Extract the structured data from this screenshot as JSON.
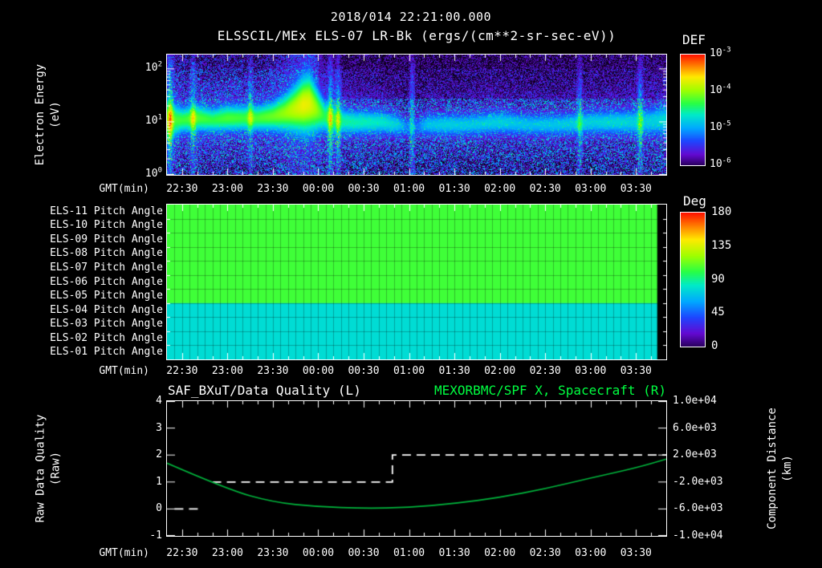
{
  "title": "2018/014 22:21:00.000",
  "subtitle_left": "ELSSCIL/MEx ELS-07 LR-Bk",
  "subtitle_right": "(ergs/(cm**2-sr-sec-eV))",
  "gmt_label": "GMT(min)",
  "time_ticks": [
    "22:30",
    "23:00",
    "23:30",
    "00:00",
    "00:30",
    "01:00",
    "01:30",
    "02:00",
    "02:30",
    "03:00",
    "03:30"
  ],
  "colors": {
    "background": "#000000",
    "text": "#ffffff",
    "accent_green": "#00ff41",
    "curve_green": "#00b43c"
  },
  "spectrogram": {
    "ylabel_line1": "Electron Energy",
    "ylabel_line2": "(eV)",
    "y_ticks": [
      {
        "base": "10",
        "exp": "2"
      },
      {
        "base": "10",
        "exp": "1"
      },
      {
        "base": "10",
        "exp": "0"
      }
    ],
    "colorbar": {
      "title": "DEF",
      "ticks": [
        {
          "base": "10",
          "exp": "-3"
        },
        {
          "base": "10",
          "exp": "-4"
        },
        {
          "base": "10",
          "exp": "-5"
        },
        {
          "base": "10",
          "exp": "-6"
        }
      ]
    }
  },
  "pitch_panel": {
    "rows": [
      "ELS-11 Pitch Angle",
      "ELS-10 Pitch Angle",
      "ELS-09 Pitch Angle",
      "ELS-08 Pitch Angle",
      "ELS-07 Pitch Angle",
      "ELS-06 Pitch Angle",
      "ELS-05 Pitch Angle",
      "ELS-04 Pitch Angle",
      "ELS-03 Pitch Angle",
      "ELS-02 Pitch Angle",
      "ELS-01 Pitch Angle"
    ],
    "colorbar": {
      "title": "Deg",
      "ticks": [
        "180",
        "135",
        "90",
        "45",
        "0"
      ]
    }
  },
  "line_chart": {
    "title_left": "SAF_BXuT/Data Quality (L)",
    "title_right": "MEXORBMC/SPF X, Spacecraft (R)",
    "left_axis": {
      "label_line1": "Raw Data Quality",
      "label_line2": "(Raw)",
      "ticks": [
        "4",
        "3",
        "2",
        "1",
        "0",
        "-1"
      ]
    },
    "right_axis": {
      "label_line1": "Component Distance",
      "label_line2": "(km)",
      "ticks": [
        "1.0e+04",
        "6.0e+03",
        "2.0e+03",
        "-2.0e+03",
        "-6.0e+03",
        "-1.0e+04"
      ]
    }
  },
  "chart_data": [
    {
      "type": "heatmap",
      "title": "ELSSCIL/MEx ELS-07 LR-Bk",
      "units": "ergs/(cm**2-sr-sec-eV)",
      "xlabel": "GMT(min)",
      "x_start": "22:20",
      "x_end": "03:50",
      "x_span_minutes": 330,
      "x_ticks": [
        "22:30",
        "23:00",
        "23:30",
        "00:00",
        "00:30",
        "01:00",
        "01:30",
        "02:00",
        "02:30",
        "03:00",
        "03:30"
      ],
      "ylabel": "Electron Energy (eV)",
      "y_scale": "log",
      "y_ticks_eV": [
        1,
        10,
        100
      ],
      "y_top_eV": 186,
      "colorbar": {
        "label": "DEF",
        "scale": "log",
        "ticks": [
          "1e-3",
          "1e-4",
          "1e-5",
          "1e-6"
        ],
        "range": [
          1e-06,
          0.001
        ]
      },
      "band": {
        "t_min": [
          0,
          10,
          20,
          30,
          40,
          50,
          60,
          70,
          78,
          85,
          90,
          94,
          98,
          104,
          112,
          122,
          132,
          142,
          152,
          159,
          164,
          172,
          185,
          200,
          220,
          240,
          260,
          280,
          300,
          315,
          330
        ],
        "intensity": [
          0.78,
          0.74,
          0.77,
          0.72,
          0.76,
          0.74,
          0.76,
          0.8,
          0.86,
          0.94,
          1.0,
          0.98,
          0.88,
          0.7,
          0.64,
          0.62,
          0.6,
          0.58,
          0.52,
          0.34,
          0.3,
          0.48,
          0.52,
          0.5,
          0.52,
          0.48,
          0.5,
          0.52,
          0.54,
          0.5,
          0.55
        ],
        "center_eV": [
          11,
          11,
          12,
          11,
          12,
          12,
          12,
          13,
          15,
          18,
          21,
          22,
          18,
          13,
          11,
          10,
          10,
          10,
          9,
          8,
          8,
          9,
          9,
          9,
          10,
          9,
          9,
          10,
          10,
          10,
          11
        ],
        "width_decades": [
          0.3,
          0.19,
          0.2,
          0.18,
          0.2,
          0.19,
          0.19,
          0.22,
          0.28,
          0.36,
          0.42,
          0.44,
          0.36,
          0.24,
          0.2,
          0.18,
          0.18,
          0.17,
          0.16,
          0.14,
          0.14,
          0.16,
          0.16,
          0.16,
          0.17,
          0.16,
          0.16,
          0.17,
          0.18,
          0.2,
          0.22
        ]
      },
      "streaks": {
        "t_min": [
          2,
          17,
          55,
          108,
          113,
          162,
          273,
          313
        ],
        "strength": [
          0.45,
          0.3,
          0.25,
          0.42,
          0.36,
          0.3,
          0.26,
          0.32
        ]
      },
      "noise_seed": 42
    },
    {
      "type": "heatmap",
      "rows": [
        "ELS-11",
        "ELS-10",
        "ELS-09",
        "ELS-08",
        "ELS-07",
        "ELS-06",
        "ELS-05",
        "ELS-04",
        "ELS-03",
        "ELS-02",
        "ELS-01"
      ],
      "row_values_deg": [
        105,
        105,
        105,
        105,
        105,
        105,
        105,
        78,
        78,
        78,
        78
      ],
      "colorbar": {
        "label": "Deg",
        "ticks": [
          180,
          135,
          90,
          45,
          0
        ],
        "range": [
          0,
          180
        ]
      },
      "grid_columns": 66,
      "data_gap_right_min": 6,
      "x_span_minutes": 330
    },
    {
      "type": "line",
      "x_start": "22:20",
      "x_end": "03:50",
      "x_span_minutes": 330,
      "x_ticks": [
        "22:30",
        "23:00",
        "23:30",
        "00:00",
        "00:30",
        "01:00",
        "01:30",
        "02:00",
        "02:30",
        "03:00",
        "03:30"
      ],
      "left_axis": {
        "label": "Raw Data Quality (Raw)",
        "range": [
          -1,
          4
        ]
      },
      "right_axis": {
        "label": "Component Distance (km)",
        "range": [
          -10000,
          10000
        ]
      },
      "series": [
        {
          "name": "SAF_BXuT/Data Quality (L)",
          "axis": "left",
          "line": "dashed",
          "color": "#ffffff",
          "steps": [
            {
              "t0": 5,
              "t1": 22,
              "value": 0
            },
            {
              "t0": 30,
              "t1": 149,
              "value": 1
            },
            {
              "t0": 149,
              "t1": 330,
              "value": 2
            }
          ]
        },
        {
          "name": "MEXORBMC/SPF X, Spacecraft (R)",
          "axis": "right",
          "line": "solid",
          "color": "#00b43c",
          "t_min": [
            0,
            40,
            70,
            100,
            130,
            160,
            190,
            220,
            250,
            280,
            310,
            330
          ],
          "km": [
            800,
            -3100,
            -5000,
            -5700,
            -5900,
            -5800,
            -5200,
            -4300,
            -3000,
            -1400,
            100,
            1400
          ]
        }
      ]
    }
  ]
}
